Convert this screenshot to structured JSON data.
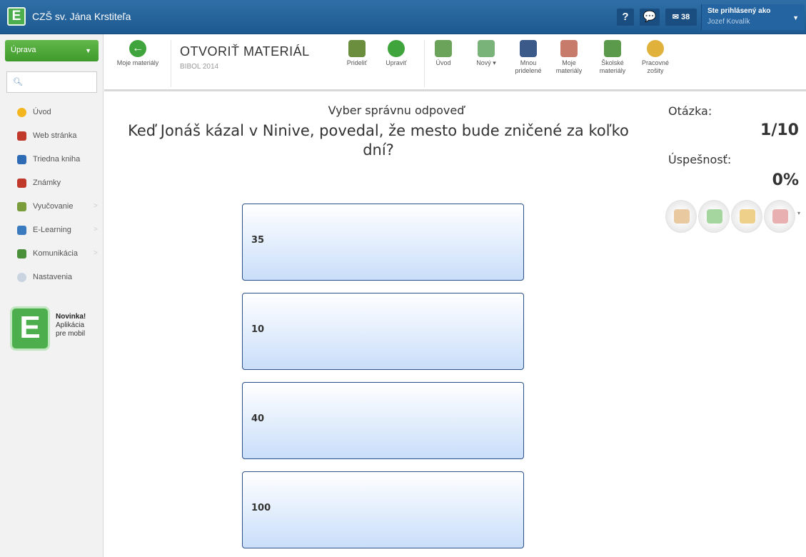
{
  "header": {
    "app_title": "CZŠ sv. Jána Krstiteľa",
    "help_label": "?",
    "mail_count": "38",
    "user_line1": "Ste prihlásený ako",
    "user_line2": "Jozef Kovalík"
  },
  "sidebar": {
    "dropdown_label": "Úprava",
    "items": [
      {
        "label": "Úvod",
        "icon": "star-icon",
        "color": "#f3b61f"
      },
      {
        "label": "Web stránka",
        "icon": "books-icon",
        "color": "#c0392b"
      },
      {
        "label": "Triedna kniha",
        "icon": "pen-icon",
        "color": "#2e6bb5"
      },
      {
        "label": "Známky",
        "icon": "grades-icon",
        "color": "#c0392b"
      },
      {
        "label": "Vyučovanie",
        "icon": "hand-icon",
        "color": "#7a9c3b"
      },
      {
        "label": "E-Learning",
        "icon": "elearning-icon",
        "color": "#3a7abf"
      },
      {
        "label": "Komunikácia",
        "icon": "people-icon",
        "color": "#4a8f3a"
      },
      {
        "label": "Nastavenia",
        "icon": "settings-icon",
        "color": "#c9d4e0"
      }
    ],
    "promo": {
      "line1": "Novinka!",
      "line2": "Aplikácia",
      "line3": "pre mobil"
    }
  },
  "toolbar": {
    "back_label": "Moje materiály",
    "title": "OTVORIŤ MATERIÁL",
    "subtitle": "BIBOL 2014",
    "assign_label": "Prideliť",
    "edit_label": "Upraviť",
    "intro_label": "Úvod",
    "new_label": "Nový",
    "new_caret": "▾",
    "assigned_label1": "Mnou",
    "assigned_label2": "pridelené",
    "my_label1": "Moje",
    "my_label2": "materiály",
    "school_label1": "Školské",
    "school_label2": "materiály",
    "workbooks_label1": "Pracovné",
    "workbooks_label2": "zošity"
  },
  "quiz": {
    "instruction": "Vyber správnu odpoveď",
    "question": "Keď Jonáš kázal v Ninive, povedal, že mesto bude zničené za koľko dní?",
    "answers": [
      "35",
      "10",
      "40",
      "100"
    ]
  },
  "status": {
    "question_label": "Otázka:",
    "question_value": "1/10",
    "success_label": "Úspešnosť:",
    "success_value": "0%"
  },
  "jokers": {
    "caret": "▾",
    "items": [
      {
        "icon": "audience-icon",
        "color": "#e8c9a0"
      },
      {
        "icon": "screen-icon",
        "color": "#a6d6a0"
      },
      {
        "icon": "fifty-fifty-icon",
        "color": "#efd08a"
      },
      {
        "icon": "hands-icon",
        "color": "#e8b0b0"
      }
    ]
  }
}
